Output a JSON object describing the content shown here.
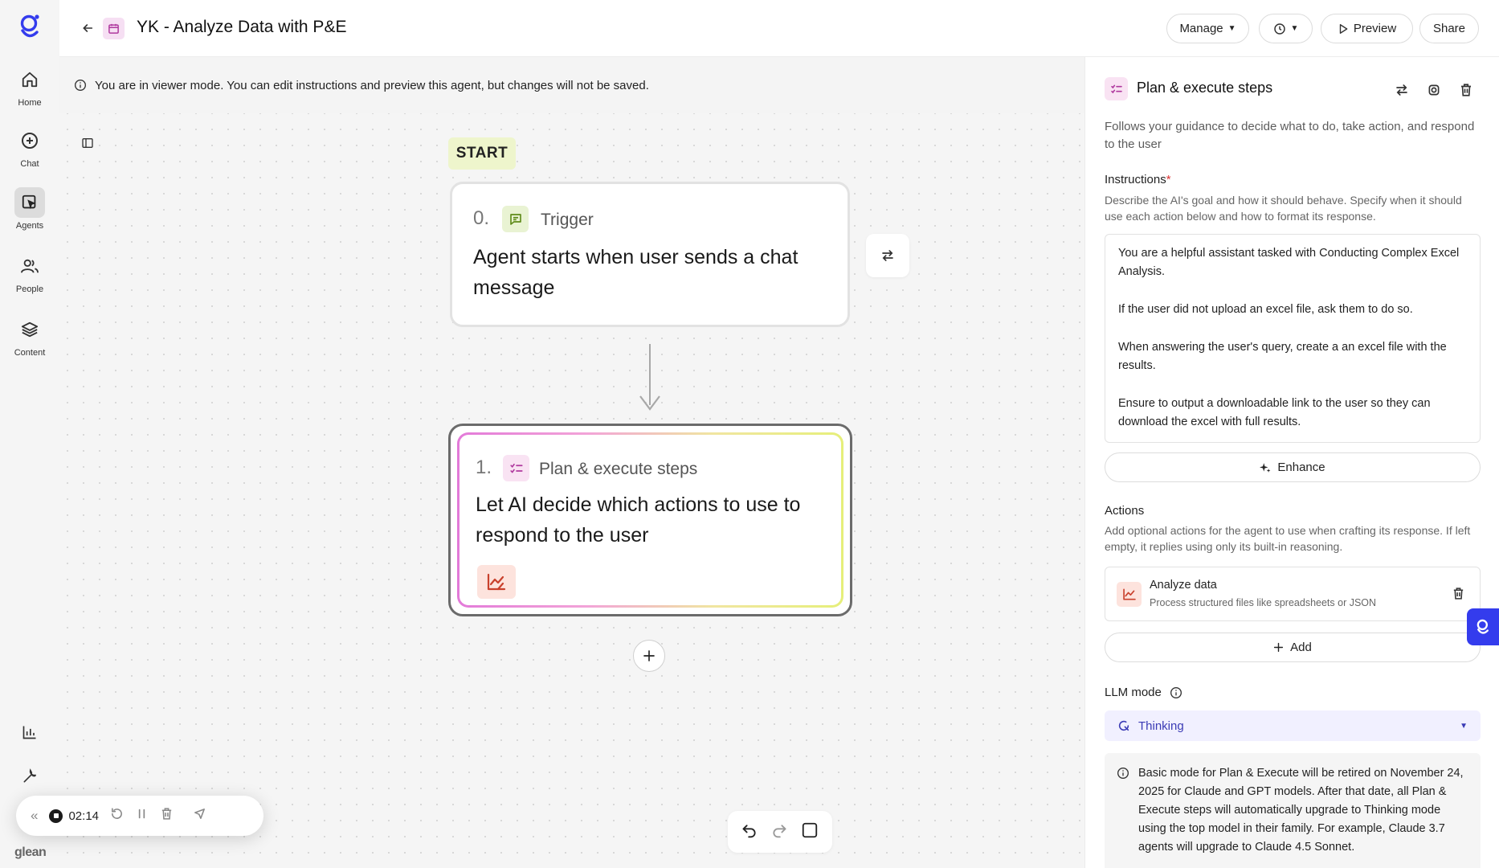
{
  "sidebar": {
    "brand": "glean",
    "items": [
      {
        "label": "Home"
      },
      {
        "label": "Chat"
      },
      {
        "label": "Agents"
      },
      {
        "label": "People"
      },
      {
        "label": "Content"
      }
    ]
  },
  "header": {
    "title": "YK - Analyze Data with P&E",
    "manage_label": "Manage",
    "preview_label": "Preview",
    "share_label": "Share"
  },
  "banner": {
    "text": "You are in viewer mode. You can edit instructions and preview this agent, but changes will not be saved."
  },
  "flow": {
    "start_label": "START",
    "trigger": {
      "number": "0.",
      "kind": "Trigger",
      "body": "Agent starts when user sends a chat message"
    },
    "plan": {
      "number": "1.",
      "kind": "Plan & execute steps",
      "body": "Let AI decide which actions to use to respond to the user"
    }
  },
  "recorder": {
    "time": "02:14"
  },
  "panel": {
    "title": "Plan & execute steps",
    "description": "Follows your guidance to decide what to do, take action, and respond to the user",
    "instructions_label": "Instructions",
    "instructions_required": "*",
    "instructions_help": "Describe the AI's goal and how it should behave. Specify when it should use each action below and how to format its response.",
    "instructions": [
      "You are a helpful assistant tasked with Conducting Complex Excel Analysis.",
      "If the user did not upload an excel file, ask them to do so.",
      "When answering the user's query, create a an excel file with the results.",
      "Ensure to output a downloadable link to the user so they can download the excel with full results."
    ],
    "enhance_label": "Enhance",
    "actions_label": "Actions",
    "actions_help": "Add optional actions for the agent to use when crafting its response. If left empty, it replies using only its built-in reasoning.",
    "action": {
      "name": "Analyze data",
      "description": "Process structured files like spreadsheets or JSON"
    },
    "add_label": "Add",
    "llm_label": "LLM mode",
    "llm_value": "Thinking",
    "notice": "Basic mode for Plan & Execute will be retired on November 24, 2025 for Claude and GPT models. After that date, all Plan & Execute steps will automatically upgrade to Thinking mode using the top model in their family. For example, Claude 3.7 agents will upgrade to Claude 4.5 Sonnet."
  },
  "colors": {
    "accent": "#343ced",
    "start_badge": "#eef5cc",
    "llm_select_bg": "#f1f0ff"
  }
}
